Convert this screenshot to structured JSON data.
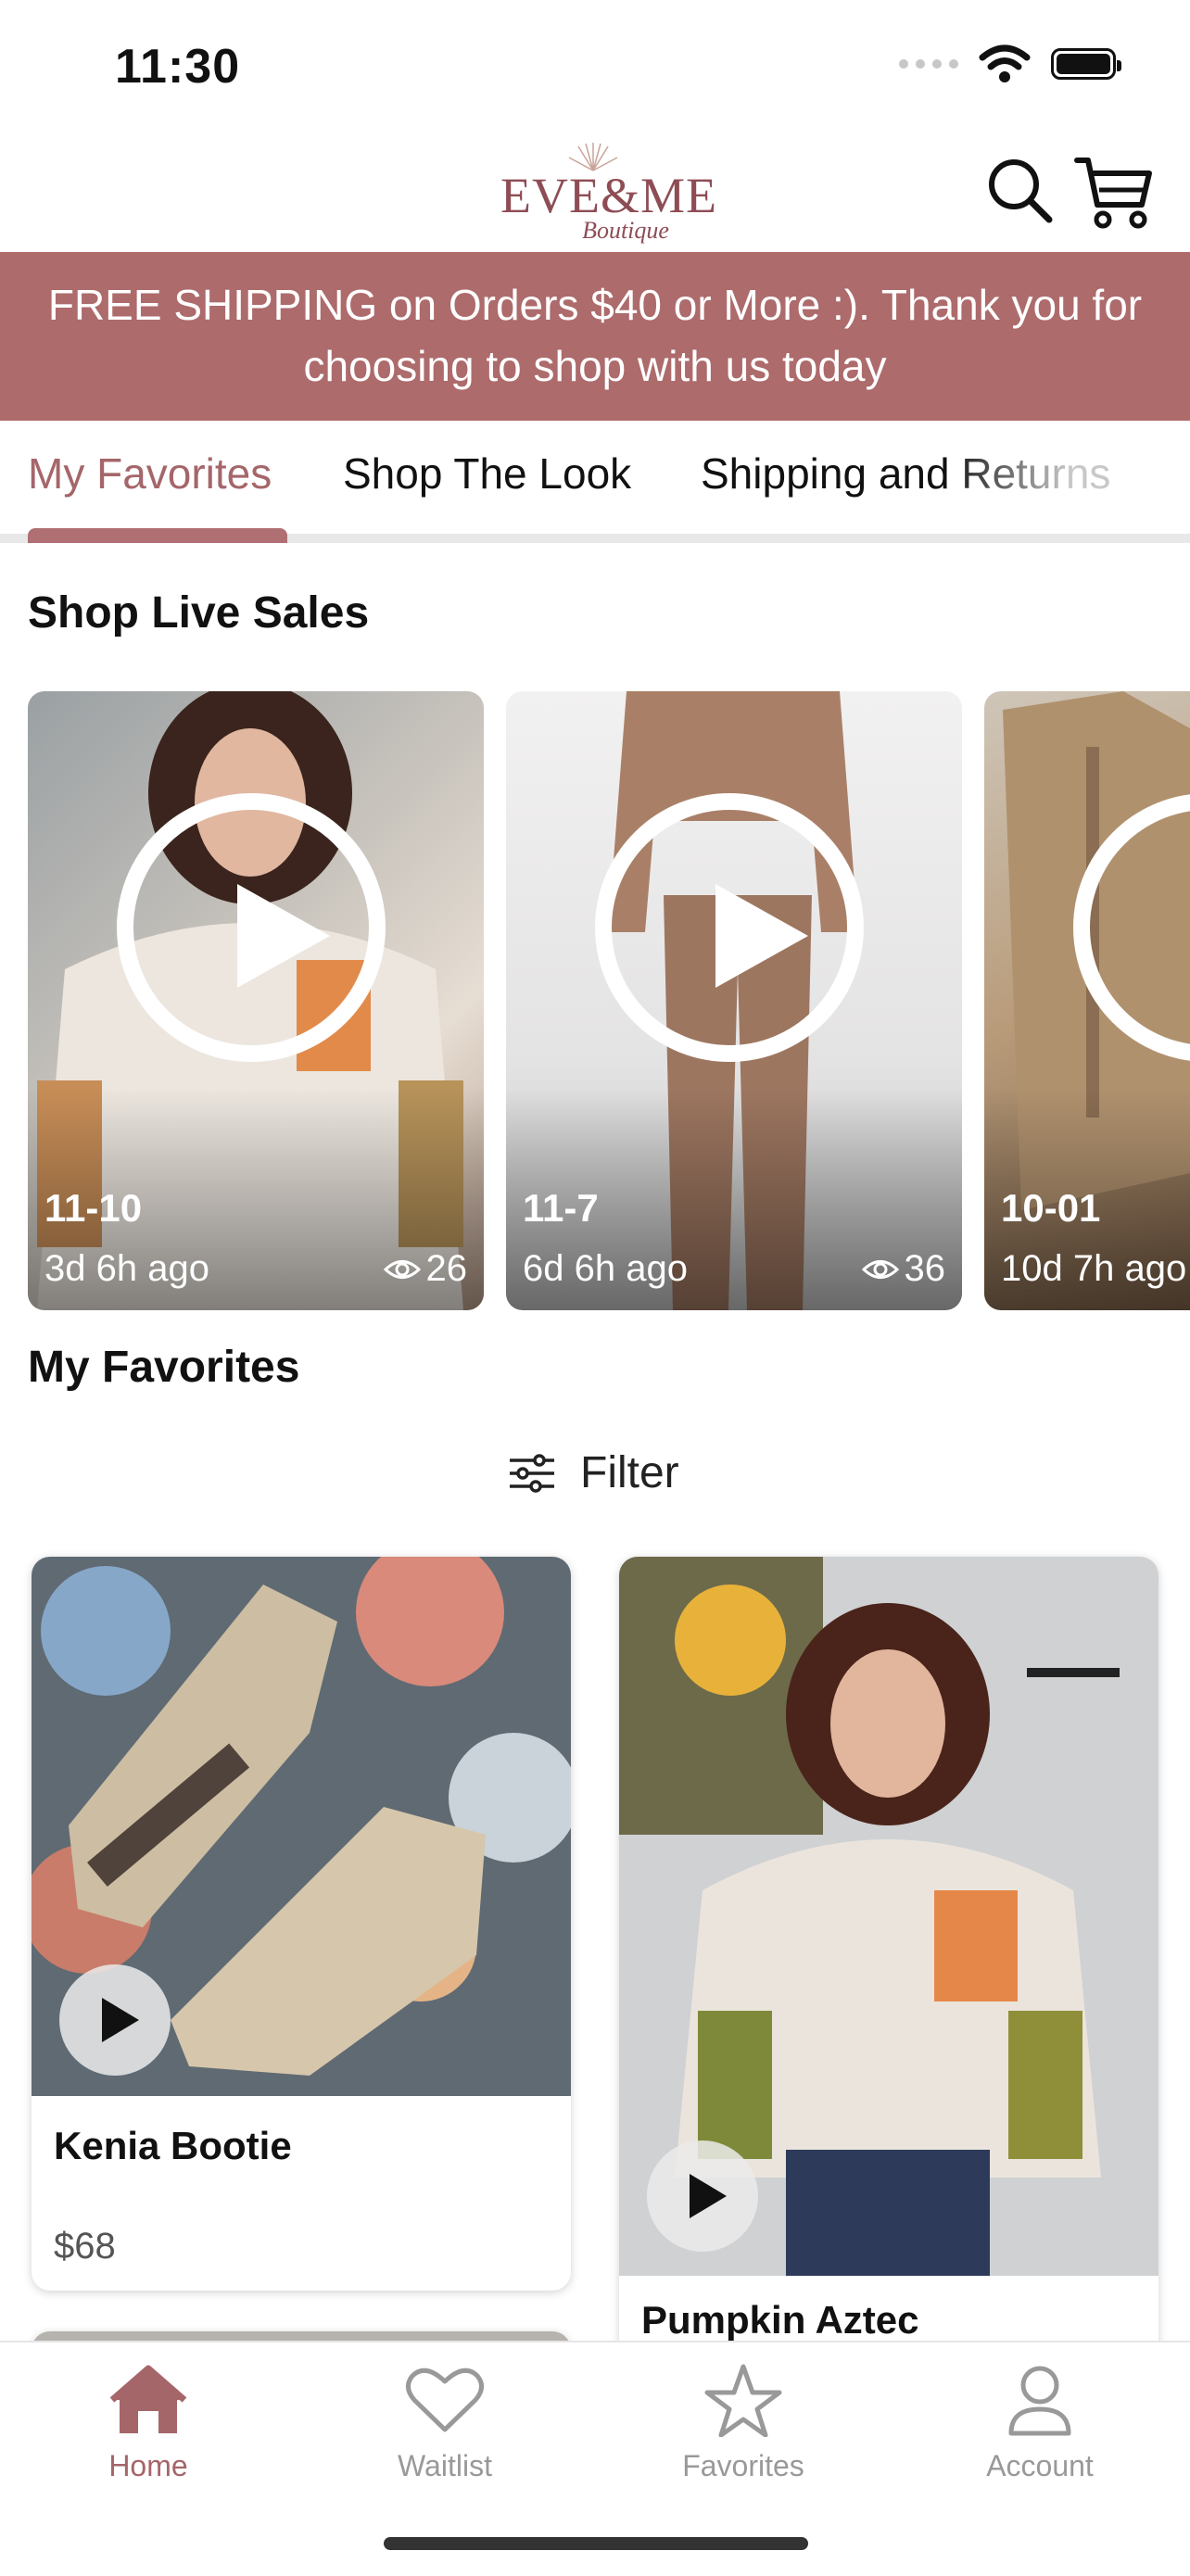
{
  "status_bar": {
    "time": "11:30"
  },
  "header": {
    "logo_main": "EVE&ME",
    "logo_sub": "Boutique",
    "icons": [
      "search-icon",
      "cart-icon"
    ]
  },
  "banner": {
    "line1": "FREE SHIPPING on Orders $40 or More :). Thank you for",
    "line2": "choosing to shop with us today",
    "color": "#ad6b6c"
  },
  "tabs": [
    {
      "label": "My Favorites",
      "active": true
    },
    {
      "label": "Shop The Look",
      "active": false
    },
    {
      "label": "Shipping and Returns",
      "active": false
    }
  ],
  "live_sales": {
    "title": "Shop Live Sales",
    "items": [
      {
        "name": "11-10",
        "ago": "3d 6h ago",
        "views": "26"
      },
      {
        "name": "11-7",
        "ago": "6d 6h ago",
        "views": "36"
      },
      {
        "name": "10-01",
        "ago": "10d 7h ago",
        "views": ""
      }
    ]
  },
  "favorites": {
    "title": "My Favorites",
    "filter_label": "Filter",
    "products": [
      {
        "name": "Kenia Bootie",
        "price": "$68"
      },
      {
        "name": "Pumpkin Aztec",
        "price": ""
      }
    ]
  },
  "bottom_nav": [
    {
      "label": "Home",
      "icon": "home-icon",
      "active": true
    },
    {
      "label": "Waitlist",
      "icon": "heart-icon",
      "active": false
    },
    {
      "label": "Favorites",
      "icon": "star-icon",
      "active": false
    },
    {
      "label": "Account",
      "icon": "person-icon",
      "active": false
    }
  ],
  "colors": {
    "accent": "#a5666a",
    "banner": "#ad6b6c"
  }
}
